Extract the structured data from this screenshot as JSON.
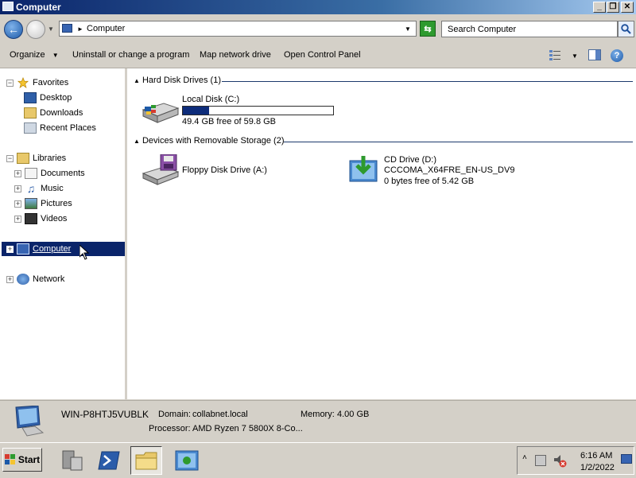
{
  "window": {
    "title": "Computer",
    "controls": {
      "minimize": "_",
      "restore": "❐",
      "close": "✕"
    }
  },
  "address": {
    "location": "Computer",
    "search_placeholder": "Search Computer"
  },
  "toolbar": {
    "organize": "Organize",
    "uninstall": "Uninstall or change a program",
    "map_drive": "Map network drive",
    "control_panel": "Open Control Panel"
  },
  "nav": {
    "favorites": "Favorites",
    "desktop": "Desktop",
    "downloads": "Downloads",
    "recent": "Recent Places",
    "libraries": "Libraries",
    "documents": "Documents",
    "music": "Music",
    "pictures": "Pictures",
    "videos": "Videos",
    "computer": "Computer",
    "network": "Network"
  },
  "content": {
    "hdd_group": "Hard Disk Drives (1)",
    "removable_group": "Devices with Removable Storage (2)",
    "local_disk": {
      "name": "Local Disk (C:)",
      "free_text": "49.4 GB free of 59.8 GB",
      "used_fraction": 0.174
    },
    "floppy": {
      "name": "Floppy Disk Drive (A:)"
    },
    "cd": {
      "name": "CD Drive (D:)",
      "label": "CCCOMA_X64FRE_EN-US_DV9",
      "free_text": "0 bytes free of 5.42 GB"
    }
  },
  "details": {
    "computer_name": "WIN-P8HTJ5VUBLK",
    "domain_label": "Domain:",
    "domain_value": "collabnet.local",
    "memory_label": "Memory:",
    "memory_value": "4.00 GB",
    "processor_label": "Processor:",
    "processor_value": "AMD Ryzen 7 5800X 8-Co..."
  },
  "taskbar": {
    "start_label": "Start",
    "time": "6:16 AM",
    "date": "1/2/2022"
  },
  "colors": {
    "selection": "#0a246a",
    "drive_fill": "#0d2c7a",
    "title_gradient_start": "#0a246a"
  }
}
